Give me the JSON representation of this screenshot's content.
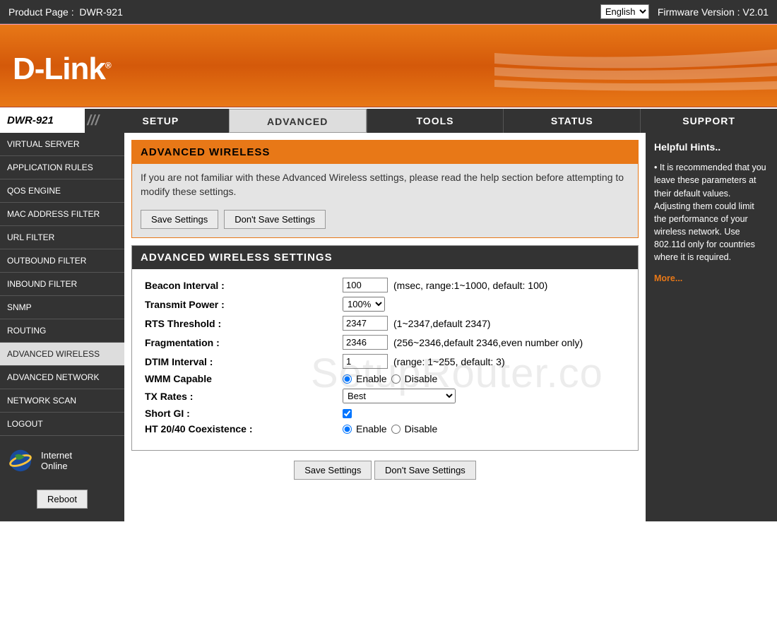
{
  "topbar": {
    "product_page_label": "Product Page :",
    "product_model": "DWR-921",
    "language_selected": "English",
    "firmware_label": "Firmware Version :",
    "firmware_version": "V2.01"
  },
  "brand": "D-Link",
  "model_tab": "DWR-921",
  "main_tabs": [
    "SETUP",
    "ADVANCED",
    "TOOLS",
    "STATUS",
    "SUPPORT"
  ],
  "main_tab_active": 1,
  "sidebar": {
    "items": [
      "VIRTUAL SERVER",
      "APPLICATION RULES",
      "QOS ENGINE",
      "MAC ADDRESS FILTER",
      "URL FILTER",
      "OUTBOUND FILTER",
      "INBOUND FILTER",
      "SNMP",
      "ROUTING",
      "ADVANCED WIRELESS",
      "ADVANCED NETWORK",
      "NETWORK SCAN",
      "LOGOUT"
    ],
    "active_index": 9,
    "status_line1": "Internet",
    "status_line2": "Online",
    "reboot_label": "Reboot"
  },
  "orange": {
    "title": "ADVANCED WIRELESS",
    "warning": "If you are not familiar with these Advanced Wireless settings, please read the help section before attempting to modify these settings.",
    "save": "Save Settings",
    "dont_save": "Don't Save Settings"
  },
  "settings": {
    "title": "ADVANCED WIRELESS SETTINGS",
    "beacon": {
      "label": "Beacon Interval :",
      "value": "100",
      "hint": "(msec, range:1~1000, default: 100)"
    },
    "txpower": {
      "label": "Transmit Power :",
      "value": "100%"
    },
    "rts": {
      "label": "RTS Threshold :",
      "value": "2347",
      "hint": "(1~2347,default 2347)"
    },
    "frag": {
      "label": "Fragmentation :",
      "value": "2346",
      "hint": "(256~2346,default 2346,even number only)"
    },
    "dtim": {
      "label": "DTIM Interval :",
      "value": "1",
      "hint": "(range: 1~255, default: 3)"
    },
    "wmm": {
      "label": "WMM Capable",
      "enable": "Enable",
      "disable": "Disable"
    },
    "txrates": {
      "label": "TX Rates :",
      "value": "Best"
    },
    "shortgi": {
      "label": "Short GI :"
    },
    "ht2040": {
      "label": "HT 20/40 Coexistence :",
      "enable": "Enable",
      "disable": "Disable"
    }
  },
  "bottom_buttons": {
    "save": "Save Settings",
    "dont_save": "Don't Save Settings"
  },
  "hints": {
    "title": "Helpful Hints..",
    "body": "• It is recommended that you leave these parameters at their default values. Adjusting them could limit the performance of your wireless network. Use 802.11d only for countries where it is required.",
    "more": "More..."
  },
  "watermark": "SetupRouter.co"
}
